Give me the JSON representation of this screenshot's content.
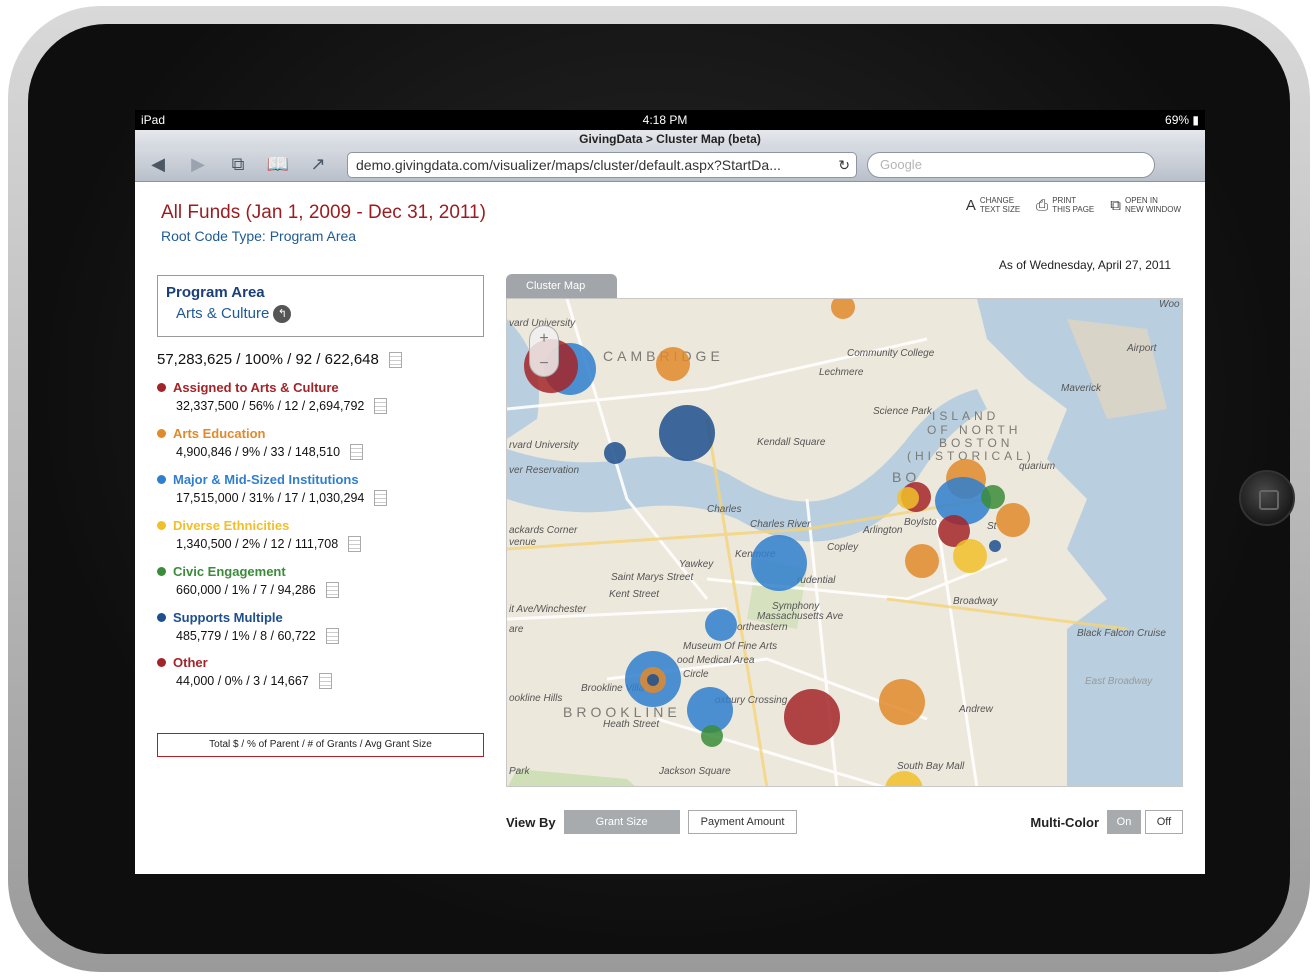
{
  "device": {
    "status_left": "iPad",
    "time": "4:18 PM",
    "battery": "69%"
  },
  "browser": {
    "page_title": "GivingData > Cluster Map (beta)",
    "url": "demo.givingdata.com/visualizer/maps/cluster/default.aspx?StartDa...",
    "search_placeholder": "Google"
  },
  "header": {
    "title": "All Funds (Jan 1, 2009 - Dec 31, 2011)",
    "subtitle": "Root Code Type: Program Area",
    "tools": [
      {
        "icon": "text-size-icon",
        "label1": "CHANGE",
        "label2": "TEXT SIZE"
      },
      {
        "icon": "print-icon",
        "label1": "PRINT",
        "label2": "THIS PAGE"
      },
      {
        "icon": "new-window-icon",
        "label1": "OPEN IN",
        "label2": "NEW WINDOW"
      }
    ],
    "as_of": "As of Wednesday, April 27, 2011"
  },
  "program_area": {
    "title": "Program Area",
    "item": "Arts & Culture"
  },
  "total_stats": "57,283,625 / 100% / 92 / 622,648",
  "categories": [
    {
      "name": "Assigned to Arts & Culture",
      "stats": "32,337,500 / 56% / 12 / 2,694,792",
      "color": "#a32428"
    },
    {
      "name": "Arts Education",
      "stats": "4,900,846 / 9% / 33 / 148,510",
      "color": "#e08a2c"
    },
    {
      "name": "Major & Mid-Sized Institutions",
      "stats": "17,515,000 / 31% / 17 / 1,030,294",
      "color": "#2f7fce"
    },
    {
      "name": "Diverse Ethnicities",
      "stats": "1,340,500 / 2% / 12 / 111,708",
      "color": "#f1bf2a"
    },
    {
      "name": "Civic Engagement",
      "stats": "660,000 / 1% / 7 / 94,286",
      "color": "#3b8c3a"
    },
    {
      "name": "Supports Multiple",
      "stats": "485,779 / 1% / 8 / 60,722",
      "color": "#1d4f8e"
    },
    {
      "name": "Other",
      "stats": "44,000 / 0% / 3 / 14,667",
      "color": "#a32428"
    }
  ],
  "legend_key": "Total $  /  % of Parent  /  # of Grants  /  Avg Grant Size",
  "map": {
    "tab_label": "Cluster Map",
    "zoom_in": "+",
    "zoom_out": "−",
    "labels": {
      "cambridge": "CAMBRIDGE",
      "brookline": "BROOKLINE",
      "boston": "BO",
      "island_north": "ISLAND",
      "north_end_1": "OF NORTH",
      "north_end_2": "BOSTON",
      "north_end_3": "(HISTORICAL)",
      "harvard_top": "vard University",
      "harvard2": "rvard University",
      "reservation": "ver Reservation",
      "community_college": "Community College",
      "lechmere": "Lechmere",
      "science_park": "Science Park",
      "kendall": "Kendall Square",
      "charles_river": "Charles River",
      "charles": "Charles",
      "arlington": "Arlington",
      "copley": "Copley",
      "kenmore": "Kenmore",
      "yawkey": "Yawkey",
      "saint_marys": "Saint Marys Street",
      "prudential": "rudential",
      "kent_street": "Kent Street",
      "symphony": "Symphony",
      "mass_ave": "Massachusetts Ave",
      "northeastern": "ortheastern",
      "museum": "Museum Of Fine Arts",
      "medical": "ood Medical Area",
      "circle": "Circle",
      "brookline_village": "Brookline Villa",
      "brookline_hills": "ookline Hills",
      "heath": "Heath Street",
      "roxbury": "oxbury Crossing",
      "jackson": "Jackson Square",
      "broadway": "Broadway",
      "andrew": "Andrew",
      "south_bay": "South Bay Mall",
      "black_falcon": "Black Falcon Cruise",
      "airport": "Airport",
      "maverick": "Maverick",
      "aquarium": "quarium",
      "boylston": "Boylsto",
      "st": "St",
      "winchester": "it Ave/Winchester",
      "pickards": "ackards Corner",
      "avenue": "venue",
      "are": "are",
      "park": "Park",
      "woo": "Woo",
      "east_broadway": "East Broadway"
    }
  },
  "controls": {
    "view_by_label": "View By",
    "grant_size": "Grant Size",
    "payment_amount": "Payment Amount",
    "multi_color_label": "Multi-Color",
    "on": "On",
    "off": "Off"
  }
}
